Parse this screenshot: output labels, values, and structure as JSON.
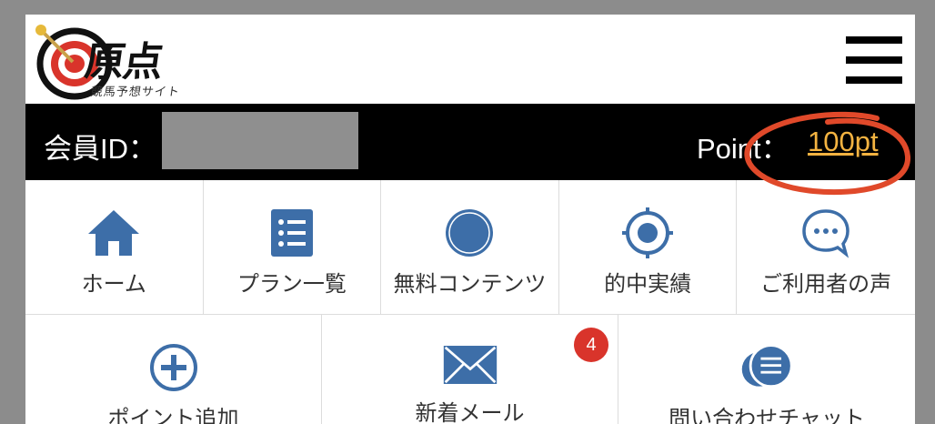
{
  "header": {
    "logo_text": "原点",
    "logo_subtext": "競馬予想サイト",
    "menu_icon": "hamburger-menu-icon"
  },
  "member_bar": {
    "member_label": "会員ID：",
    "point_label": "Point：",
    "point_value": "100pt"
  },
  "nav": {
    "row1": [
      {
        "label": "ホーム",
        "icon": "home-icon"
      },
      {
        "label": "プラン一覧",
        "icon": "list-icon"
      },
      {
        "label": "無料コンテンツ",
        "icon": "badge-circle-icon"
      },
      {
        "label": "的中実績",
        "icon": "target-icon"
      },
      {
        "label": "ご利用者の声",
        "icon": "chat-bubble-icon"
      }
    ],
    "row2": [
      {
        "label": "ポイント追加",
        "icon": "plus-circle-icon"
      },
      {
        "label": "新着メール",
        "icon": "mail-icon",
        "badge": "4"
      },
      {
        "label": "問い合わせチャット",
        "icon": "chat-lines-icon"
      }
    ]
  },
  "colors": {
    "accent_blue": "#3d6ea8",
    "point_orange": "#f3b341",
    "badge_red": "#d9342b",
    "annotation_red": "#e0492a"
  }
}
